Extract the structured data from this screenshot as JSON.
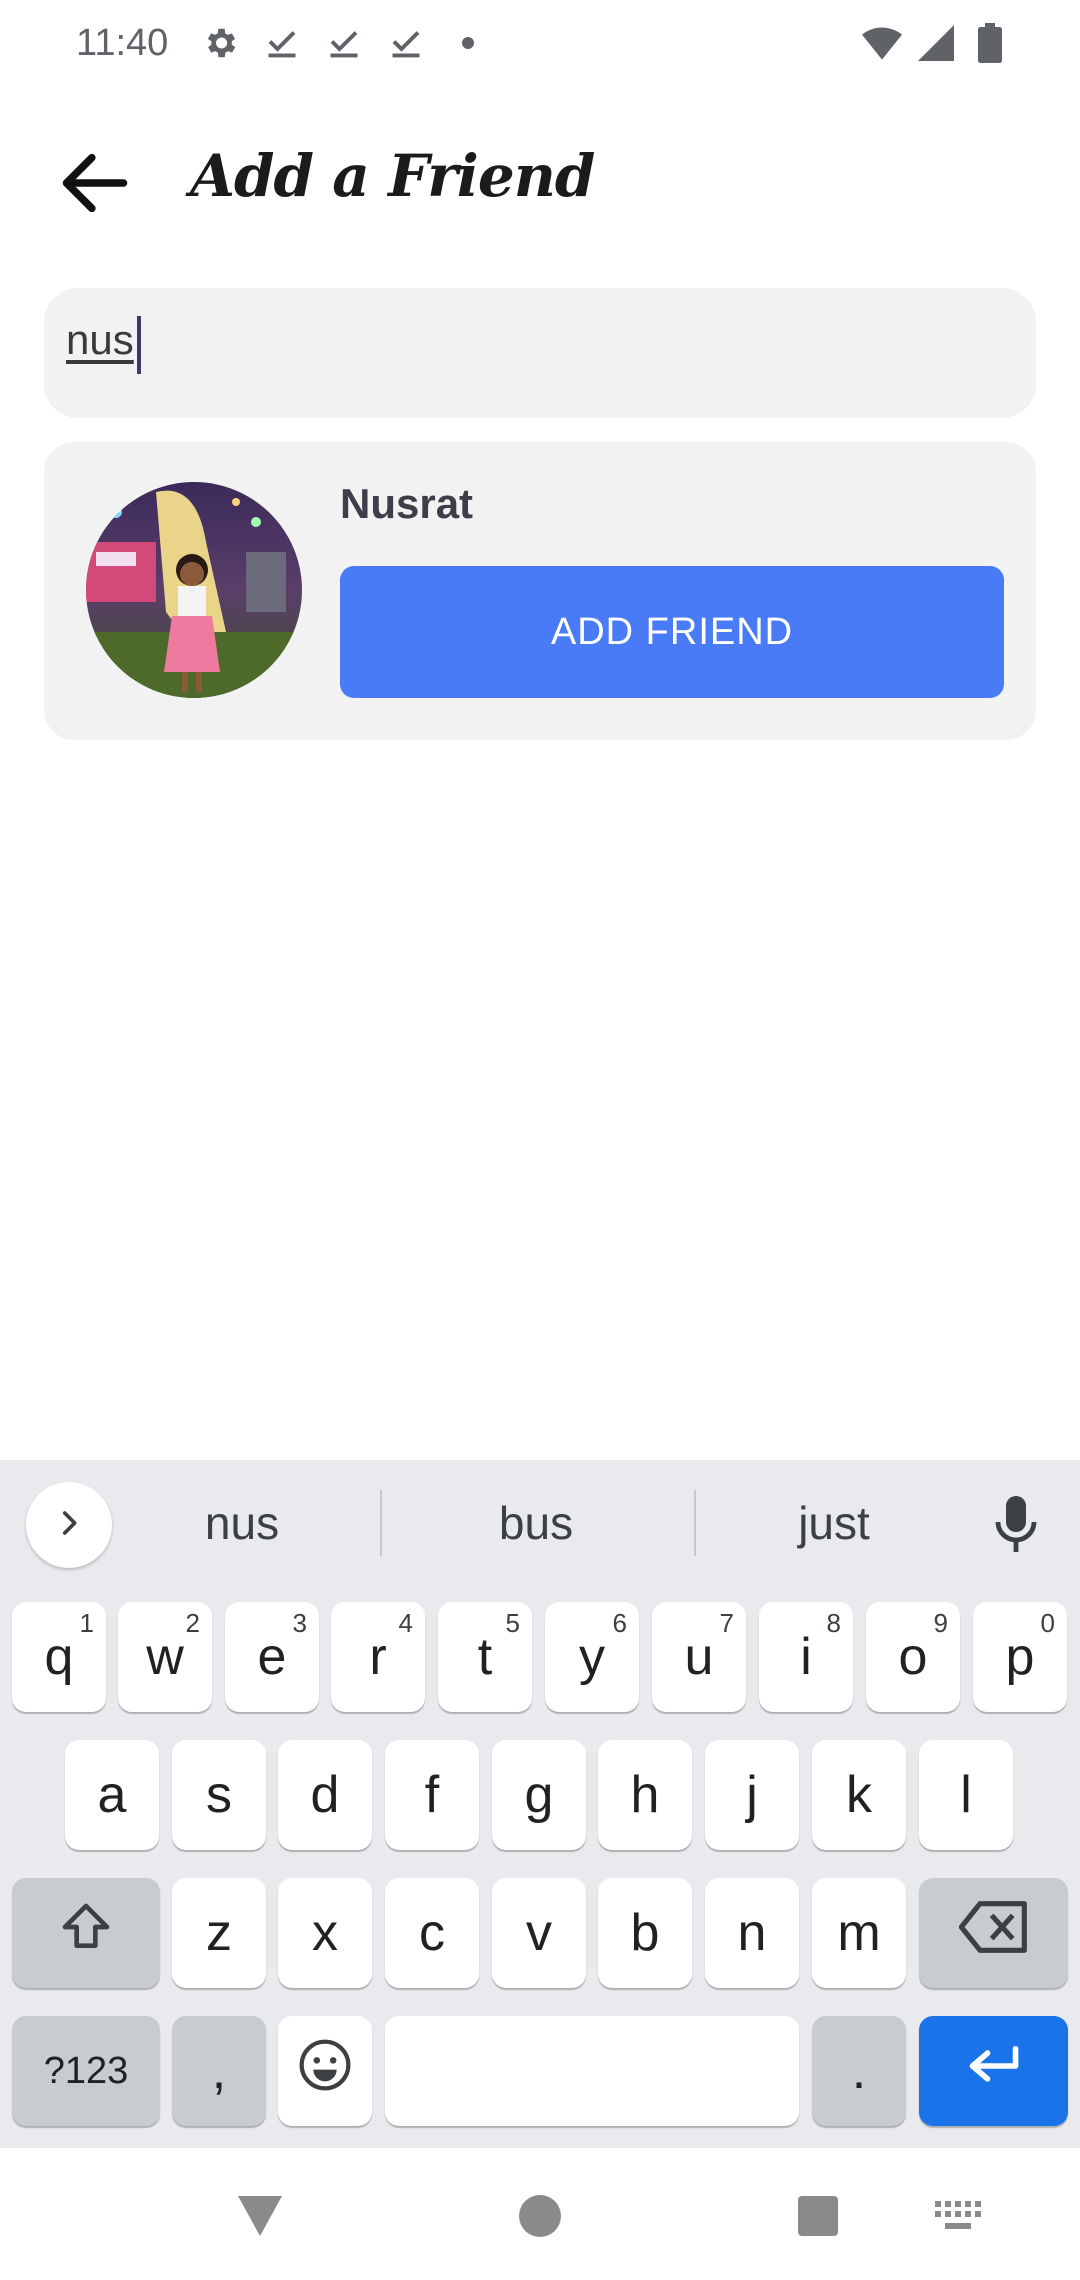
{
  "status_bar": {
    "time": "11:40",
    "left_icons": [
      "gear-icon",
      "download-done-icon",
      "download-done-icon",
      "download-done-icon",
      "dot-icon"
    ],
    "right_icons": [
      "wifi-icon",
      "signal-icon",
      "battery-icon"
    ]
  },
  "header": {
    "title": "Add a Friend",
    "back_icon": "arrow-back-icon"
  },
  "search": {
    "value": "nus"
  },
  "results": [
    {
      "name": "Nusrat",
      "button_label": "ADD FRIEND"
    }
  ],
  "keyboard": {
    "suggestions": [
      "nus",
      "bus",
      "just"
    ],
    "row1": [
      {
        "key": "q",
        "hint": "1"
      },
      {
        "key": "w",
        "hint": "2"
      },
      {
        "key": "e",
        "hint": "3"
      },
      {
        "key": "r",
        "hint": "4"
      },
      {
        "key": "t",
        "hint": "5"
      },
      {
        "key": "y",
        "hint": "6"
      },
      {
        "key": "u",
        "hint": "7"
      },
      {
        "key": "i",
        "hint": "8"
      },
      {
        "key": "o",
        "hint": "9"
      },
      {
        "key": "p",
        "hint": "0"
      }
    ],
    "row2": [
      "a",
      "s",
      "d",
      "f",
      "g",
      "h",
      "j",
      "k",
      "l"
    ],
    "row3": [
      "z",
      "x",
      "c",
      "v",
      "b",
      "n",
      "m"
    ],
    "symbols_label": "?123",
    "comma_label": ",",
    "period_label": "."
  },
  "colors": {
    "accent": "#4a7bf7",
    "enter_key": "#1a73e8",
    "card_bg": "#f2f2f2",
    "keyboard_bg": "#e8eaed"
  }
}
